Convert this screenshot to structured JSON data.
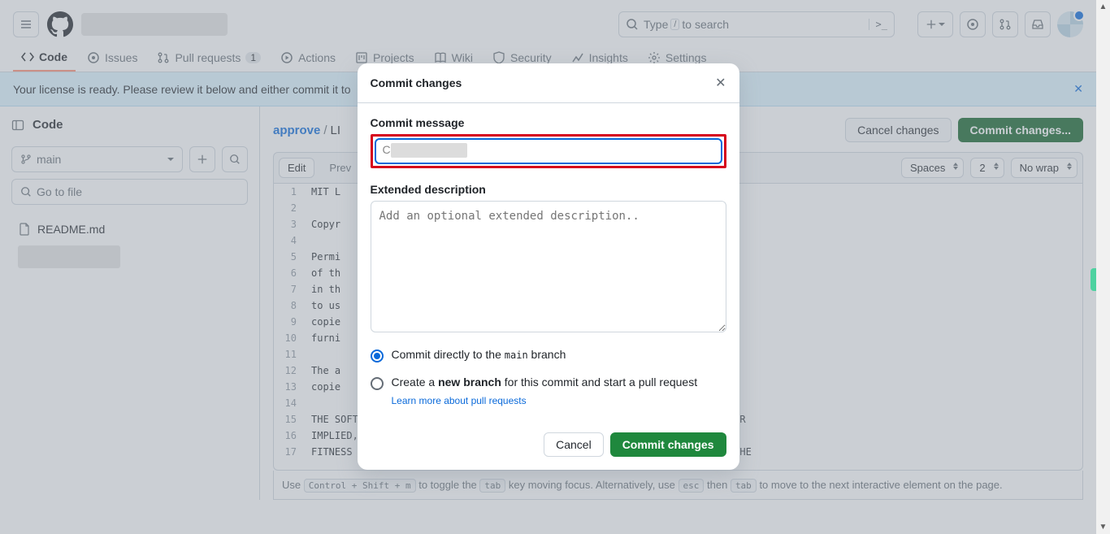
{
  "header": {
    "search_placeholder": "Type",
    "search_suffix": "to search",
    "slash_key": "/"
  },
  "tabs": {
    "code": "Code",
    "issues": "Issues",
    "pulls": "Pull requests",
    "pulls_count": "1",
    "actions": "Actions",
    "projects": "Projects",
    "wiki": "Wiki",
    "security": "Security",
    "insights": "Insights",
    "settings": "Settings"
  },
  "banner": {
    "text": "Your license is ready. Please review it below and either commit it to"
  },
  "sidebar": {
    "title": "Code",
    "branch": "main",
    "filter_placeholder": "Go to file",
    "file1": "README.md"
  },
  "crumbs": {
    "repo": "approve",
    "file_prefix": "LI"
  },
  "page_actions": {
    "cancel": "Cancel changes",
    "commit": "Commit changes..."
  },
  "editor": {
    "edit_tab": "Edit",
    "preview_tab": "Prev",
    "indent": "Spaces",
    "indent_size": "2",
    "wrap": "No wrap",
    "lines": [
      "MIT L",
      "",
      "Copyr",
      "",
      "Permi",
      "of th",
      "in th",
      "to us",
      "copie",
      "furni",
      "",
      "The a",
      "copie",
      "",
      "THE SOFTWARE IS PROVIDED \"AS IS\", WITHOUT WARRANTY OF ANY KIND, EXPRESS OR",
      "IMPLIED, INCLUDING BUT NOT LIMITED TO THE WARRANTIES OF MERCHANTABILITY,",
      "FITNESS FOR A PARTICULAR PURPOSE AND NONINFRINGEMENT. IN NO EVENT SHALL THE"
    ]
  },
  "hint": {
    "prefix": "Use",
    "k1": "Control + Shift + m",
    "mid1": "to toggle the",
    "k2": "tab",
    "mid2": "key moving focus. Alternatively, use",
    "k3": "esc",
    "mid3": "then",
    "k4": "tab",
    "suffix": "to move to the next interactive element on the page."
  },
  "modal": {
    "title": "Commit changes",
    "msg_label": "Commit message",
    "msg_prefix": "C",
    "desc_label": "Extended description",
    "desc_placeholder": "Add an optional extended description..",
    "radio1_a": "Commit directly to the ",
    "radio1_code": "main",
    "radio1_b": " branch",
    "radio2_a": "Create a ",
    "radio2_bold": "new branch",
    "radio2_b": " for this commit and start a pull request",
    "learn": "Learn more about pull requests",
    "cancel": "Cancel",
    "submit": "Commit changes"
  }
}
